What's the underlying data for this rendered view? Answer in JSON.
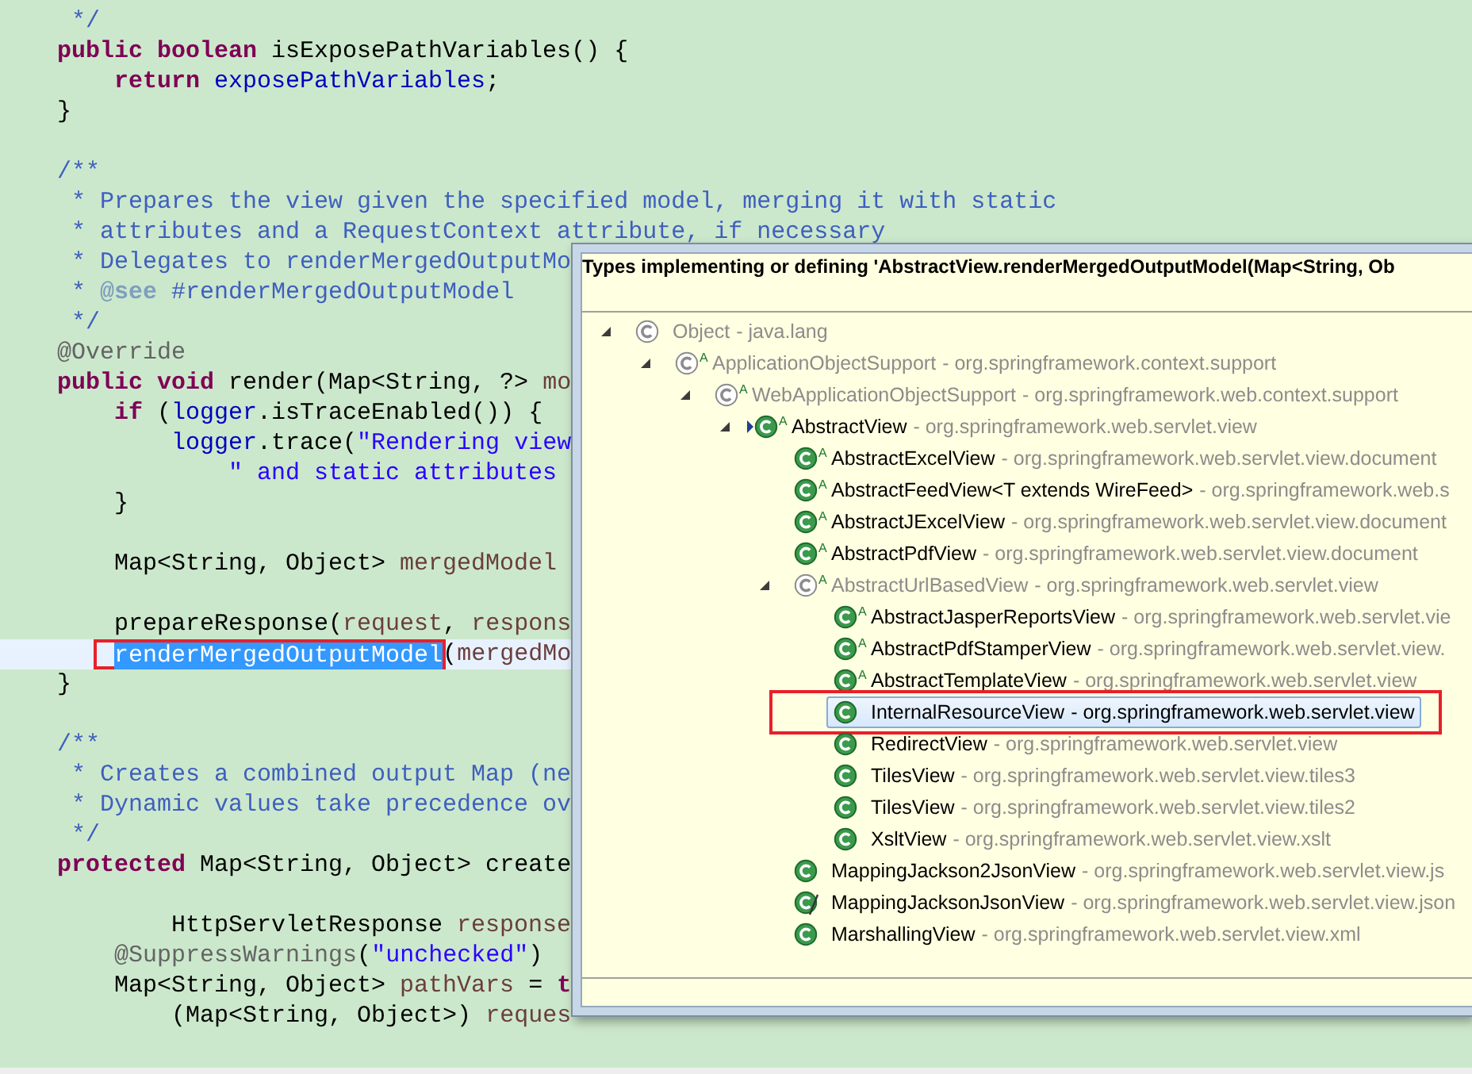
{
  "editor": {
    "lines": [
      {
        "current": false,
        "tokens": [
          {
            "kind": "comment",
            "text": "     */"
          }
        ]
      },
      {
        "current": false,
        "tokens": [
          {
            "kind": "keyword",
            "text": "    public boolean"
          },
          {
            "kind": "plain",
            "text": " isExposePathVariables() {"
          }
        ]
      },
      {
        "current": false,
        "tokens": [
          {
            "kind": "keyword",
            "text": "        return "
          },
          {
            "kind": "field",
            "text": "exposePathVariables"
          },
          {
            "kind": "plain",
            "text": ";"
          }
        ]
      },
      {
        "current": false,
        "tokens": [
          {
            "kind": "plain",
            "text": "    }"
          }
        ]
      },
      {
        "current": false
      },
      {
        "current": false,
        "tokens": [
          {
            "kind": "comment",
            "text": "    /**"
          }
        ]
      },
      {
        "current": false,
        "tokens": [
          {
            "kind": "comment",
            "text": "     * Prepares the view given the specified model, merging it with static"
          }
        ]
      },
      {
        "current": false,
        "tokens": [
          {
            "kind": "comment",
            "text": "     * attributes and a RequestContext attribute, if necessary"
          }
        ]
      },
      {
        "current": false,
        "tokens": [
          {
            "kind": "comment",
            "text": "     * Delegates to renderMergedOutputMo"
          }
        ]
      },
      {
        "current": false,
        "tokens": [
          {
            "kind": "comment",
            "text": "     * "
          },
          {
            "kind": "tag",
            "text": "@see"
          },
          {
            "kind": "comment",
            "text": " #renderMergedOutputModel"
          }
        ]
      },
      {
        "current": false,
        "tokens": [
          {
            "kind": "comment",
            "text": "     */"
          }
        ]
      },
      {
        "current": false,
        "tokens": [
          {
            "kind": "annotation",
            "text": "    @Override"
          }
        ]
      },
      {
        "current": false,
        "tokens": [
          {
            "kind": "keyword",
            "text": "    public void"
          },
          {
            "kind": "plain",
            "text": " render(Map<String, ?> "
          },
          {
            "kind": "local",
            "text": "mo"
          }
        ]
      },
      {
        "current": false,
        "tokens": [
          {
            "kind": "keyword",
            "text": "        if"
          },
          {
            "kind": "plain",
            "text": " ("
          },
          {
            "kind": "field",
            "text": "logger"
          },
          {
            "kind": "plain",
            "text": ".isTraceEnabled()) {"
          }
        ]
      },
      {
        "current": false,
        "tokens": [
          {
            "kind": "field",
            "text": "            logger"
          },
          {
            "kind": "plain",
            "text": ".trace("
          },
          {
            "kind": "string",
            "text": "\"Rendering view"
          }
        ]
      },
      {
        "current": false,
        "tokens": [
          {
            "kind": "string",
            "text": "                \" and static attributes"
          }
        ]
      },
      {
        "current": false,
        "tokens": [
          {
            "kind": "plain",
            "text": "        }"
          }
        ]
      },
      {
        "current": false
      },
      {
        "current": false,
        "tokens": [
          {
            "kind": "plain",
            "text": "        Map<String, Object> "
          },
          {
            "kind": "local",
            "text": "mergedModel"
          }
        ]
      },
      {
        "current": false
      },
      {
        "current": false,
        "tokens": [
          {
            "kind": "plain",
            "text": "        prepareResponse("
          },
          {
            "kind": "local",
            "text": "request"
          },
          {
            "kind": "plain",
            "text": ", "
          },
          {
            "kind": "local",
            "text": "respons"
          }
        ]
      },
      {
        "current": true,
        "tokens": [
          {
            "kind": "selection",
            "text": "renderMergedOutputModel",
            "boxed": true
          },
          {
            "kind": "plain",
            "text": "("
          },
          {
            "kind": "local",
            "text": "mergedMo"
          }
        ]
      },
      {
        "current": false,
        "tokens": [
          {
            "kind": "plain",
            "text": "    }"
          }
        ]
      },
      {
        "current": false
      },
      {
        "current": false,
        "tokens": [
          {
            "kind": "comment",
            "text": "    /**"
          }
        ]
      },
      {
        "current": false,
        "tokens": [
          {
            "kind": "comment",
            "text": "     * Creates a combined output Map (ne"
          }
        ]
      },
      {
        "current": false,
        "tokens": [
          {
            "kind": "comment",
            "text": "     * Dynamic values take precedence ov"
          }
        ]
      },
      {
        "current": false,
        "tokens": [
          {
            "kind": "comment",
            "text": "     */"
          }
        ]
      },
      {
        "current": false,
        "tokens": [
          {
            "kind": "keyword",
            "text": "    protected"
          },
          {
            "kind": "plain",
            "text": " Map<String, Object> create"
          }
        ]
      },
      {
        "current": false
      },
      {
        "current": false,
        "tokens": [
          {
            "kind": "plain",
            "text": "            HttpServletResponse "
          },
          {
            "kind": "local",
            "text": "response"
          }
        ]
      },
      {
        "current": false,
        "tokens": [
          {
            "kind": "annotation",
            "text": "        @SuppressWarnings"
          },
          {
            "kind": "plain",
            "text": "("
          },
          {
            "kind": "string",
            "text": "\"unchecked\""
          },
          {
            "kind": "plain",
            "text": ")"
          }
        ]
      },
      {
        "current": false,
        "tokens": [
          {
            "kind": "plain",
            "text": "        Map<String, Object> "
          },
          {
            "kind": "local",
            "text": "pathVars"
          },
          {
            "kind": "plain",
            "text": " = "
          },
          {
            "kind": "keyword",
            "text": "t"
          }
        ]
      },
      {
        "current": false,
        "tokens": [
          {
            "kind": "plain",
            "text": "            (Map<String, Object>) "
          },
          {
            "kind": "local",
            "text": "reques"
          }
        ]
      }
    ]
  },
  "popup": {
    "title": "Types implementing or defining 'AbstractView.renderMergedOutputModel(Map<String, Ob",
    "tree": [
      {
        "name": "Object",
        "package": "- java.lang",
        "defines": false,
        "deprecated": false,
        "override_marker": false,
        "selected": false,
        "boxed": false,
        "expanded": true,
        "children": [
          {
            "name": "ApplicationObjectSupport",
            "badge": "A",
            "package": "- org.springframework.context.support",
            "defines": false,
            "deprecated": false,
            "override_marker": false,
            "selected": false,
            "boxed": false,
            "expanded": true,
            "children": [
              {
                "name": "WebApplicationObjectSupport",
                "badge": "A",
                "package": "- org.springframework.web.context.support",
                "defines": false,
                "deprecated": false,
                "override_marker": false,
                "selected": false,
                "boxed": false,
                "expanded": true,
                "children": [
                  {
                    "name": "AbstractView",
                    "badge": "A",
                    "package": "- org.springframework.web.servlet.view",
                    "defines": true,
                    "deprecated": false,
                    "override_marker": true,
                    "selected": false,
                    "boxed": false,
                    "expanded": true,
                    "children": [
                      {
                        "name": "AbstractExcelView",
                        "badge": "A",
                        "package": "- org.springframework.web.servlet.view.document",
                        "defines": true,
                        "deprecated": false,
                        "override_marker": false,
                        "selected": false,
                        "boxed": false
                      },
                      {
                        "name": "AbstractFeedView<T extends WireFeed>",
                        "badge": "A",
                        "package": "- org.springframework.web.s",
                        "defines": true,
                        "deprecated": false,
                        "override_marker": false,
                        "selected": false,
                        "boxed": false
                      },
                      {
                        "name": "AbstractJExcelView",
                        "badge": "A",
                        "package": "- org.springframework.web.servlet.view.document",
                        "defines": true,
                        "deprecated": false,
                        "override_marker": false,
                        "selected": false,
                        "boxed": false
                      },
                      {
                        "name": "AbstractPdfView",
                        "badge": "A",
                        "package": "- org.springframework.web.servlet.view.document",
                        "defines": true,
                        "deprecated": false,
                        "override_marker": false,
                        "selected": false,
                        "boxed": false
                      },
                      {
                        "name": "AbstractUrlBasedView",
                        "badge": "A",
                        "package": "- org.springframework.web.servlet.view",
                        "defines": false,
                        "deprecated": false,
                        "override_marker": false,
                        "selected": false,
                        "boxed": false,
                        "expanded": true,
                        "children": [
                          {
                            "name": "AbstractJasperReportsView",
                            "badge": "A",
                            "package": "- org.springframework.web.servlet.vie",
                            "defines": true,
                            "deprecated": false,
                            "override_marker": false,
                            "selected": false,
                            "boxed": false
                          },
                          {
                            "name": "AbstractPdfStamperView",
                            "badge": "A",
                            "package": "- org.springframework.web.servlet.view.",
                            "defines": true,
                            "deprecated": false,
                            "override_marker": false,
                            "selected": false,
                            "boxed": false
                          },
                          {
                            "name": "AbstractTemplateView",
                            "badge": "A",
                            "package": "- org.springframework.web.servlet.view",
                            "defines": true,
                            "deprecated": false,
                            "override_marker": false,
                            "selected": false,
                            "boxed": false
                          },
                          {
                            "name": "InternalResourceView",
                            "package": "- org.springframework.web.servlet.view",
                            "defines": true,
                            "deprecated": false,
                            "override_marker": false,
                            "selected": true,
                            "boxed": true
                          },
                          {
                            "name": "RedirectView",
                            "package": "- org.springframework.web.servlet.view",
                            "defines": true,
                            "deprecated": false,
                            "override_marker": false,
                            "selected": false,
                            "boxed": false
                          },
                          {
                            "name": "TilesView",
                            "package": "- org.springframework.web.servlet.view.tiles3",
                            "defines": true,
                            "deprecated": false,
                            "override_marker": false,
                            "selected": false,
                            "boxed": false
                          },
                          {
                            "name": "TilesView",
                            "package": "- org.springframework.web.servlet.view.tiles2",
                            "defines": true,
                            "deprecated": false,
                            "override_marker": false,
                            "selected": false,
                            "boxed": false
                          },
                          {
                            "name": "XsltView",
                            "package": "- org.springframework.web.servlet.view.xslt",
                            "defines": true,
                            "deprecated": false,
                            "override_marker": false,
                            "selected": false,
                            "boxed": false
                          }
                        ]
                      },
                      {
                        "name": "MappingJackson2JsonView",
                        "package": "- org.springframework.web.servlet.view.js",
                        "defines": true,
                        "deprecated": false,
                        "override_marker": false,
                        "selected": false,
                        "boxed": false
                      },
                      {
                        "name": "MappingJacksonJsonView",
                        "package": "- org.springframework.web.servlet.view.json",
                        "defines": true,
                        "deprecated": true,
                        "override_marker": false,
                        "selected": false,
                        "boxed": false
                      },
                      {
                        "name": "MarshallingView",
                        "package": "- org.springframework.web.servlet.view.xml",
                        "defines": true,
                        "deprecated": false,
                        "override_marker": false,
                        "selected": false,
                        "boxed": false
                      }
                    ]
                  }
                ]
              }
            ]
          }
        ]
      }
    ]
  }
}
